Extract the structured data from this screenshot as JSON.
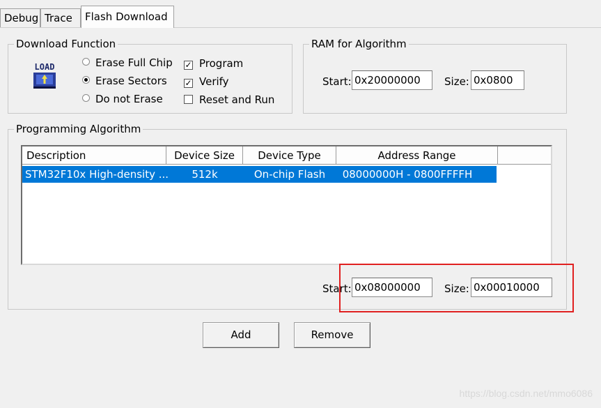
{
  "tabs": [
    {
      "label": "Debug"
    },
    {
      "label": "Trace"
    },
    {
      "label": "Flash Download"
    }
  ],
  "download_function": {
    "title": "Download Function",
    "icon": "load-icon",
    "icon_text": "LOAD",
    "erase_options": [
      {
        "label": "Erase Full Chip",
        "selected": false
      },
      {
        "label": "Erase Sectors",
        "selected": true
      },
      {
        "label": "Do not Erase",
        "selected": false
      }
    ],
    "checkboxes": [
      {
        "label": "Program",
        "checked": true
      },
      {
        "label": "Verify",
        "checked": true
      },
      {
        "label": "Reset and Run",
        "checked": false
      }
    ]
  },
  "ram_for_algorithm": {
    "title": "RAM for Algorithm",
    "start_label": "Start:",
    "start_value": "0x20000000",
    "size_label": "Size:",
    "size_value": "0x0800"
  },
  "programming_algorithm": {
    "title": "Programming Algorithm",
    "columns": [
      "Description",
      "Device Size",
      "Device Type",
      "Address Range"
    ],
    "rows": [
      {
        "description": "STM32F10x High-density ...",
        "device_size": "512k",
        "device_type": "On-chip Flash",
        "address_range": "08000000H - 0800FFFFH",
        "selected": true
      }
    ],
    "start_label": "Start:",
    "start_value": "0x08000000",
    "size_label": "Size:",
    "size_value": "0x00010000"
  },
  "buttons": {
    "add": "Add",
    "remove": "Remove"
  },
  "colors": {
    "selection": "#0078d7",
    "highlight_box": "#e02020"
  },
  "watermark": "https://blog.csdn.net/mmo6086"
}
